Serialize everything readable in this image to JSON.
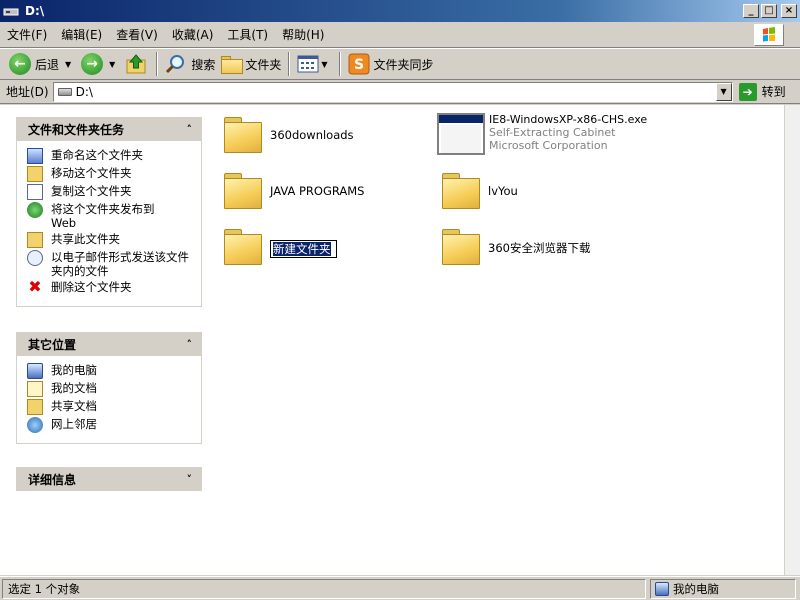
{
  "window": {
    "title": "D:\\",
    "btn_min": "_",
    "btn_max": "□",
    "btn_close": "×"
  },
  "menu": [
    "文件(F)",
    "编辑(E)",
    "查看(V)",
    "收藏(A)",
    "工具(T)",
    "帮助(H)"
  ],
  "toolbar": {
    "back": "后退",
    "search": "搜索",
    "folders": "文件夹",
    "sync": "文件夹同步"
  },
  "address": {
    "label": "地址(D)",
    "value": "D:\\",
    "go": "转到"
  },
  "tasks": {
    "file_tasks": {
      "title": "文件和文件夹任务",
      "items": [
        {
          "label": "重命名这个文件夹",
          "icon": "rename-icon"
        },
        {
          "label": "移动这个文件夹",
          "icon": "move-icon"
        },
        {
          "label": "复制这个文件夹",
          "icon": "copy-icon"
        },
        {
          "label": "将这个文件夹发布到 Web",
          "icon": "publish-icon"
        },
        {
          "label": "共享此文件夹",
          "icon": "share-icon"
        },
        {
          "label": "以电子邮件形式发送该文件夹内的文件",
          "icon": "email-icon"
        },
        {
          "label": "删除这个文件夹",
          "icon": "delete-icon"
        }
      ]
    },
    "other_places": {
      "title": "其它位置",
      "items": [
        {
          "label": "我的电脑",
          "icon": "my-computer-icon"
        },
        {
          "label": "我的文档",
          "icon": "my-documents-icon"
        },
        {
          "label": "共享文档",
          "icon": "shared-documents-icon"
        },
        {
          "label": "网上邻居",
          "icon": "network-places-icon"
        }
      ]
    },
    "details": {
      "title": "详细信息"
    }
  },
  "files": {
    "f1": "360downloads",
    "exe_name": "IE8-WindowsXP-x86-CHS.exe",
    "exe_desc": "Self-Extracting Cabinet",
    "exe_company": "Microsoft Corporation",
    "f2": "JAVA PROGRAMS",
    "f3": "lvYou",
    "f4_editing": "新建文件夹",
    "f5": "360安全浏览器下载"
  },
  "status": {
    "left": "选定 1 个对象",
    "right": "我的电脑"
  }
}
